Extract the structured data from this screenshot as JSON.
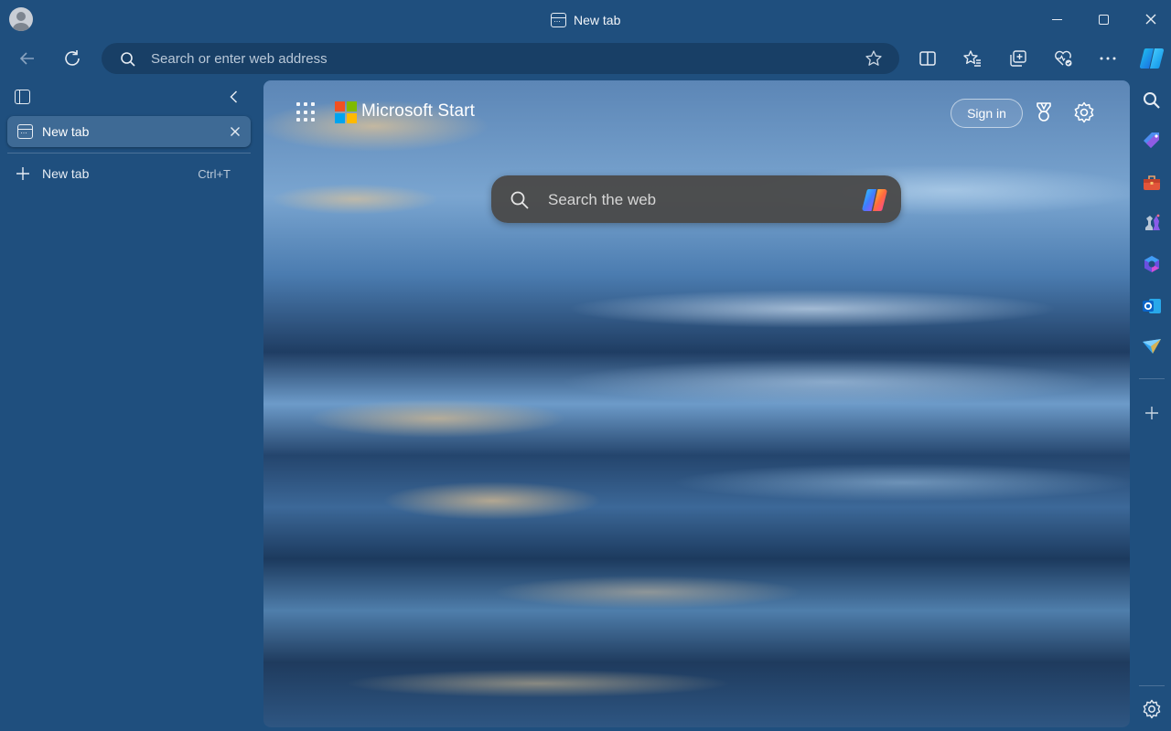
{
  "window": {
    "title": "New tab"
  },
  "toolbar": {
    "address_placeholder": "Search or enter web address"
  },
  "tabs_panel": {
    "active_tab_label": "New tab",
    "new_tab_label": "New tab",
    "new_tab_shortcut": "Ctrl+T"
  },
  "page": {
    "brand_name": "Microsoft Start",
    "sign_in_label": "Sign in",
    "search_placeholder": "Search the web"
  },
  "colors": {
    "frame": "#1f4f7e",
    "address_bg": "#183f66",
    "active_tab": "#3e6a95",
    "search_box": "#4a4a4a"
  },
  "icons": {
    "profile": "avatar-icon",
    "back": "back-arrow-icon",
    "refresh": "refresh-icon",
    "favorite": "star-icon",
    "split_screen": "split-screen-icon",
    "favorites": "favorites-icon",
    "collections": "collections-icon",
    "browser_essentials": "heart-pulse-icon",
    "more": "more-icon",
    "copilot": "copilot-icon",
    "sidebar_search": "search-icon",
    "shopping": "tag-icon",
    "tools": "toolbox-icon",
    "games": "chess-icon",
    "microsoft365": "m365-icon",
    "outlook": "outlook-icon",
    "drop": "paper-plane-icon",
    "add": "plus-icon",
    "settings": "gear-icon"
  }
}
